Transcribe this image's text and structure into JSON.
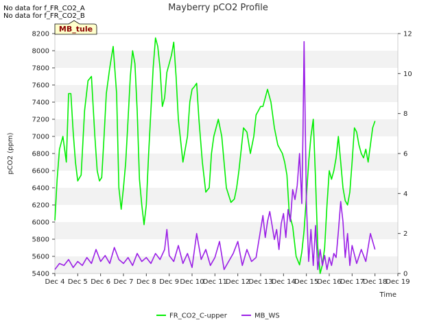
{
  "notes": [
    "No data for f_FR_CO2_A",
    "No data for f_FR_CO2_B"
  ],
  "chart_data": {
    "type": "line",
    "title": "Mayberry pCO2 Profile",
    "xlabel": "Time",
    "ylabel": "pCO2 (ppm)",
    "y2label": "",
    "site_tag": "MB_tule",
    "xlim": [
      4,
      19
    ],
    "ylim": [
      5400,
      8200
    ],
    "y2lim": [
      0,
      12
    ],
    "x_ticks": [
      {
        "v": 4,
        "label": "Dec 4"
      },
      {
        "v": 5,
        "label": "Dec 5"
      },
      {
        "v": 6,
        "label": "Dec 6"
      },
      {
        "v": 7,
        "label": "Dec 7"
      },
      {
        "v": 8,
        "label": "Dec 8"
      },
      {
        "v": 9,
        "label": "Dec 9"
      },
      {
        "v": 10,
        "label": "Dec 10"
      },
      {
        "v": 11,
        "label": "Dec 11"
      },
      {
        "v": 12,
        "label": "Dec 12"
      },
      {
        "v": 13,
        "label": "Dec 13"
      },
      {
        "v": 14,
        "label": "Dec 14"
      },
      {
        "v": 15,
        "label": "Dec 15"
      },
      {
        "v": 16,
        "label": "Dec 16"
      },
      {
        "v": 17,
        "label": "Dec 17"
      },
      {
        "v": 18,
        "label": "Dec 18"
      },
      {
        "v": 19,
        "label": "Dec 19"
      }
    ],
    "y_ticks": [
      5400,
      5600,
      5800,
      6000,
      6200,
      6400,
      6600,
      6800,
      7000,
      7200,
      7400,
      7600,
      7800,
      8000,
      8200
    ],
    "y2_ticks": [
      0,
      2,
      4,
      6,
      8,
      10,
      12
    ],
    "grid": "horizontal bands",
    "legend": "bottom-center",
    "series": [
      {
        "name": "FR_CO2_C-upper",
        "axis": "left",
        "color": "#00ee00",
        "x": [
          4.0,
          4.1,
          4.2,
          4.35,
          4.5,
          4.6,
          4.7,
          4.8,
          4.9,
          5.0,
          5.15,
          5.3,
          5.45,
          5.6,
          5.75,
          5.85,
          5.95,
          6.05,
          6.15,
          6.25,
          6.4,
          6.55,
          6.7,
          6.8,
          6.9,
          7.0,
          7.1,
          7.2,
          7.3,
          7.4,
          7.5,
          7.6,
          7.7,
          7.8,
          7.9,
          8.0,
          8.1,
          8.2,
          8.3,
          8.4,
          8.5,
          8.6,
          8.7,
          8.8,
          8.9,
          9.0,
          9.1,
          9.2,
          9.3,
          9.4,
          9.6,
          9.8,
          9.9,
          10.0,
          10.1,
          10.2,
          10.3,
          10.45,
          10.6,
          10.75,
          10.85,
          10.95,
          11.05,
          11.15,
          11.3,
          11.5,
          11.7,
          11.85,
          11.95,
          12.05,
          12.15,
          12.25,
          12.4,
          12.55,
          12.7,
          12.8,
          12.9,
          13.0,
          13.1,
          13.2,
          13.3,
          13.45,
          13.6,
          13.75,
          13.85,
          13.95,
          14.05,
          14.15,
          14.25,
          14.4,
          14.55,
          14.7,
          14.8,
          14.9,
          15.0,
          15.1,
          15.2,
          15.3,
          15.4,
          15.5,
          15.6,
          15.7,
          15.8,
          15.9,
          16.0,
          16.1,
          16.2,
          16.3,
          16.4,
          16.5,
          16.6,
          16.7,
          16.8,
          16.9,
          17.0,
          17.1,
          17.2,
          17.3,
          17.4,
          17.5,
          17.6,
          17.7,
          17.8,
          17.9,
          18.0
        ],
        "values": [
          6020,
          6500,
          6850,
          7000,
          6700,
          7500,
          7500,
          7050,
          6700,
          6480,
          6550,
          7300,
          7650,
          7700,
          7000,
          6600,
          6480,
          6520,
          7000,
          7500,
          7800,
          8050,
          7500,
          6400,
          6150,
          6400,
          6700,
          7200,
          7700,
          8000,
          7850,
          7300,
          6500,
          6200,
          5970,
          6200,
          6800,
          7300,
          7800,
          8150,
          8050,
          7800,
          7350,
          7450,
          7750,
          7850,
          7950,
          8100,
          7700,
          7200,
          6700,
          7000,
          7400,
          7550,
          7580,
          7620,
          7200,
          6700,
          6350,
          6400,
          6800,
          7000,
          7100,
          7200,
          7000,
          6400,
          6230,
          6270,
          6400,
          6600,
          6850,
          7100,
          7050,
          6800,
          7000,
          7250,
          7300,
          7350,
          7350,
          7450,
          7550,
          7400,
          7100,
          6900,
          6850,
          6800,
          6700,
          6550,
          6100,
          5950,
          5600,
          5500,
          5650,
          5900,
          6300,
          6700,
          7000,
          7200,
          6500,
          5700,
          5400,
          5500,
          5700,
          6200,
          6600,
          6500,
          6600,
          6750,
          7000,
          6700,
          6400,
          6250,
          6200,
          6350,
          6700,
          7100,
          7050,
          6900,
          6800,
          6750,
          6850,
          6700,
          6900,
          7100,
          7180
        ]
      },
      {
        "name": "MB_WS",
        "axis": "right",
        "color": "#9a1ee6",
        "x": [
          4.0,
          4.2,
          4.4,
          4.6,
          4.8,
          5.0,
          5.2,
          5.4,
          5.6,
          5.8,
          6.0,
          6.2,
          6.4,
          6.6,
          6.8,
          7.0,
          7.2,
          7.4,
          7.6,
          7.8,
          8.0,
          8.2,
          8.4,
          8.6,
          8.8,
          8.9,
          9.0,
          9.2,
          9.4,
          9.6,
          9.8,
          10.0,
          10.2,
          10.4,
          10.6,
          10.8,
          11.0,
          11.2,
          11.4,
          11.6,
          11.8,
          12.0,
          12.2,
          12.4,
          12.6,
          12.8,
          13.0,
          13.1,
          13.2,
          13.3,
          13.4,
          13.5,
          13.6,
          13.7,
          13.8,
          13.9,
          14.0,
          14.1,
          14.2,
          14.3,
          14.4,
          14.5,
          14.6,
          14.7,
          14.8,
          14.85,
          14.9,
          15.0,
          15.1,
          15.2,
          15.3,
          15.4,
          15.5,
          15.6,
          15.7,
          15.8,
          15.9,
          16.0,
          16.1,
          16.2,
          16.3,
          16.4,
          16.5,
          16.6,
          16.7,
          16.8,
          16.9,
          17.0,
          17.2,
          17.4,
          17.6,
          17.8,
          18.0
        ],
        "values": [
          0.2,
          0.5,
          0.4,
          0.7,
          0.3,
          0.6,
          0.4,
          0.8,
          0.5,
          1.2,
          0.6,
          0.9,
          0.5,
          1.3,
          0.7,
          0.5,
          0.8,
          0.4,
          1.0,
          0.6,
          0.8,
          0.5,
          1.0,
          0.7,
          1.2,
          2.2,
          0.9,
          0.6,
          1.4,
          0.5,
          1.0,
          0.3,
          2.0,
          0.7,
          1.2,
          0.4,
          0.8,
          1.6,
          0.2,
          0.6,
          1.0,
          1.6,
          0.4,
          1.2,
          0.6,
          0.8,
          2.2,
          2.9,
          1.8,
          2.6,
          3.1,
          2.4,
          1.7,
          2.2,
          1.2,
          2.5,
          3.0,
          1.8,
          3.2,
          2.6,
          4.2,
          3.7,
          4.4,
          6.0,
          3.5,
          7.0,
          11.6,
          3.5,
          0.6,
          2.2,
          0.4,
          2.4,
          0.2,
          1.2,
          0.4,
          0.9,
          0.2,
          0.8,
          0.4,
          1.0,
          0.8,
          2.1,
          3.6,
          2.6,
          0.8,
          2.0,
          0.4,
          1.4,
          0.5,
          1.2,
          0.6,
          2.0,
          1.2
        ]
      }
    ]
  }
}
